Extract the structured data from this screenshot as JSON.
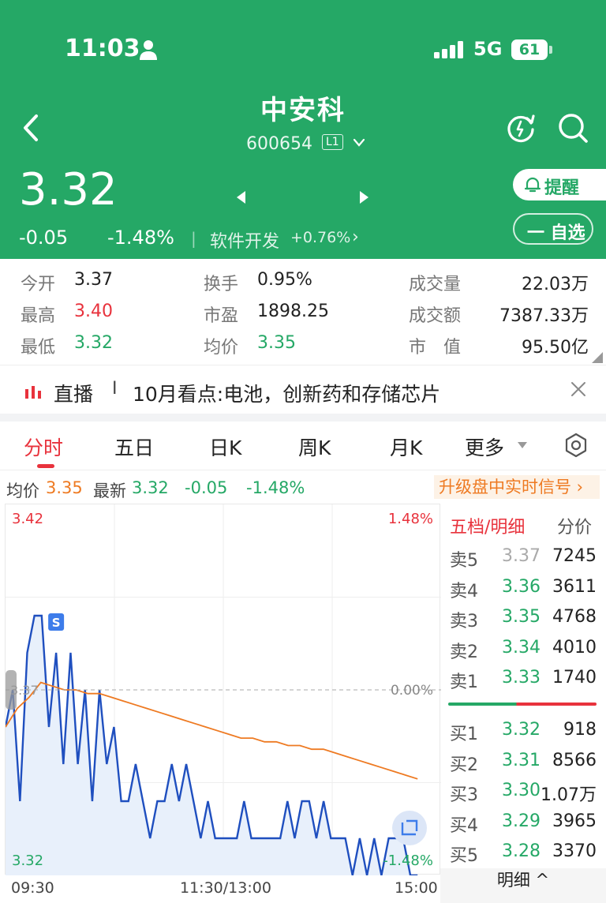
{
  "status_bar": {
    "time": "11:03",
    "network": "5G",
    "battery": "61"
  },
  "header": {
    "name": "中安科",
    "code": "600654",
    "level_badge": "L1",
    "price": "3.32",
    "change": "-0.05",
    "change_pct": "-1.48%",
    "sector": "软件开发",
    "sector_change": "+0.76%",
    "sector_arrow": "›",
    "remind_label": "提醒",
    "watch_label": "一 自选"
  },
  "stats": {
    "open_label": "今开",
    "open": "3.37",
    "high_label": "最高",
    "high": "3.40",
    "low_label": "最低",
    "low": "3.32",
    "turnover_label": "换手",
    "turnover": "0.95%",
    "pe_label": "市盈",
    "pe": "1898.25",
    "avg_label": "均价",
    "avg": "3.35",
    "volume_label": "成交量",
    "volume": "22.03万",
    "amount_label": "成交额",
    "amount": "7387.33万",
    "mcap_label": "市　值",
    "mcap": "95.50亿"
  },
  "live": {
    "label": "直播",
    "separator": "I",
    "text": "10月看点:电池，创新药和存储芯片"
  },
  "tabs": [
    "分时",
    "五日",
    "日K",
    "周K",
    "月K",
    "更多"
  ],
  "active_tab": 0,
  "info": {
    "avg_label": "均价",
    "avg": "3.35",
    "latest_label": "最新",
    "latest": "3.32",
    "change": "-0.05",
    "change_pct": "-1.48%",
    "upgrade": "升级盘中实时信号 ›"
  },
  "chart_data": {
    "type": "line",
    "y_top_label": "3.42",
    "y_bottom_label": "3.32",
    "mid_label": "3.37",
    "pct_top": "1.48%",
    "pct_mid": "0.00%",
    "pct_bottom": "-1.48%",
    "marker": "S",
    "x_labels": [
      "09:30",
      "11:30/13:00",
      "15:00"
    ],
    "ylim": [
      3.32,
      3.42
    ],
    "series": [
      {
        "values": [
          3.36,
          3.37,
          3.34,
          3.38,
          3.39,
          3.39,
          3.36,
          3.38,
          3.35,
          3.38,
          3.35,
          3.37,
          3.34,
          3.37,
          3.35,
          3.36,
          3.34,
          3.34,
          3.35,
          3.34,
          3.33,
          3.34,
          3.34,
          3.35,
          3.34,
          3.35,
          3.34,
          3.33,
          3.34,
          3.33,
          3.33,
          3.33,
          3.33,
          3.34,
          3.33,
          3.33,
          3.33,
          3.33,
          3.33,
          3.34,
          3.33,
          3.34,
          3.34,
          3.33,
          3.34,
          3.33,
          3.33,
          3.33,
          3.32,
          3.33,
          3.32,
          3.33,
          3.32,
          3.33,
          3.33,
          3.33,
          3.32,
          3.32
        ]
      },
      {
        "values": [
          3.36,
          3.365,
          3.368,
          3.372,
          3.371,
          3.37,
          3.37,
          3.369,
          3.369,
          3.368,
          3.367,
          3.366,
          3.365,
          3.364,
          3.363,
          3.362,
          3.361,
          3.36,
          3.359,
          3.358,
          3.357,
          3.357,
          3.356,
          3.356,
          3.355,
          3.355,
          3.354,
          3.354,
          3.353,
          3.352,
          3.351,
          3.35,
          3.349,
          3.348,
          3.347,
          3.346
        ]
      }
    ]
  },
  "order_book": {
    "title": "五档/明细",
    "price_tab": "分价",
    "asks": [
      {
        "level": "卖5",
        "price": "3.37",
        "volume": "7245",
        "color": "#aaaaaa"
      },
      {
        "level": "卖4",
        "price": "3.36",
        "volume": "3611",
        "color": "#25a866"
      },
      {
        "level": "卖3",
        "price": "3.35",
        "volume": "4768",
        "color": "#25a866"
      },
      {
        "level": "卖2",
        "price": "3.34",
        "volume": "4010",
        "color": "#25a866"
      },
      {
        "level": "卖1",
        "price": "3.33",
        "volume": "1740",
        "color": "#25a866"
      }
    ],
    "bids": [
      {
        "level": "买1",
        "price": "3.32",
        "volume": "918",
        "color": "#25a866"
      },
      {
        "level": "买2",
        "price": "3.31",
        "volume": "8566",
        "color": "#25a866"
      },
      {
        "level": "买3",
        "price": "3.30",
        "volume": "1.07万",
        "color": "#25a866"
      },
      {
        "level": "买4",
        "price": "3.29",
        "volume": "3965",
        "color": "#25a866"
      },
      {
        "level": "买5",
        "price": "3.28",
        "volume": "3370",
        "color": "#25a866"
      }
    ],
    "detail_label": "明细 ^"
  }
}
